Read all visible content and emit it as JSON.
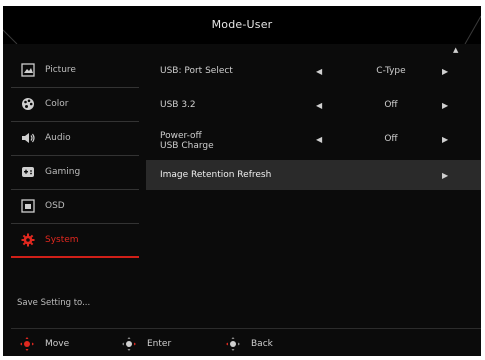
{
  "window": {
    "title": "Mode-User"
  },
  "colors": {
    "accent": "#e1281f",
    "background": "#0b0b0b",
    "highlight_row": "#2a2a2a"
  },
  "sidebar": {
    "items": [
      {
        "label": "Picture",
        "icon": "picture-icon"
      },
      {
        "label": "Color",
        "icon": "palette-icon"
      },
      {
        "label": "Audio",
        "icon": "speaker-icon"
      },
      {
        "label": "Gaming",
        "icon": "gamepad-icon"
      },
      {
        "label": "OSD",
        "icon": "osd-icon"
      },
      {
        "label": "System",
        "icon": "gear-icon",
        "active": true
      }
    ],
    "save_label": "Save Setting to..."
  },
  "settings": {
    "rows": [
      {
        "label": "USB: Port Select",
        "value": "C-Type",
        "left_arrow": "◀",
        "right_arrow": "▶"
      },
      {
        "label": "USB 3.2",
        "value": "Off",
        "left_arrow": "◀",
        "right_arrow": "▶"
      },
      {
        "label_line1": "Power-off",
        "label_line2": "USB Charge",
        "value": "Off",
        "left_arrow": "◀",
        "right_arrow": "▶"
      },
      {
        "label": "Image Retention Refresh",
        "right_arrow": "▶",
        "highlighted": true
      }
    ],
    "scroll_up_arrow": "▲"
  },
  "footer": {
    "hints": [
      {
        "label": "Move",
        "icon": "joystick-move-icon"
      },
      {
        "label": "Enter",
        "icon": "joystick-enter-icon"
      },
      {
        "label": "Back",
        "icon": "joystick-back-icon"
      }
    ]
  }
}
